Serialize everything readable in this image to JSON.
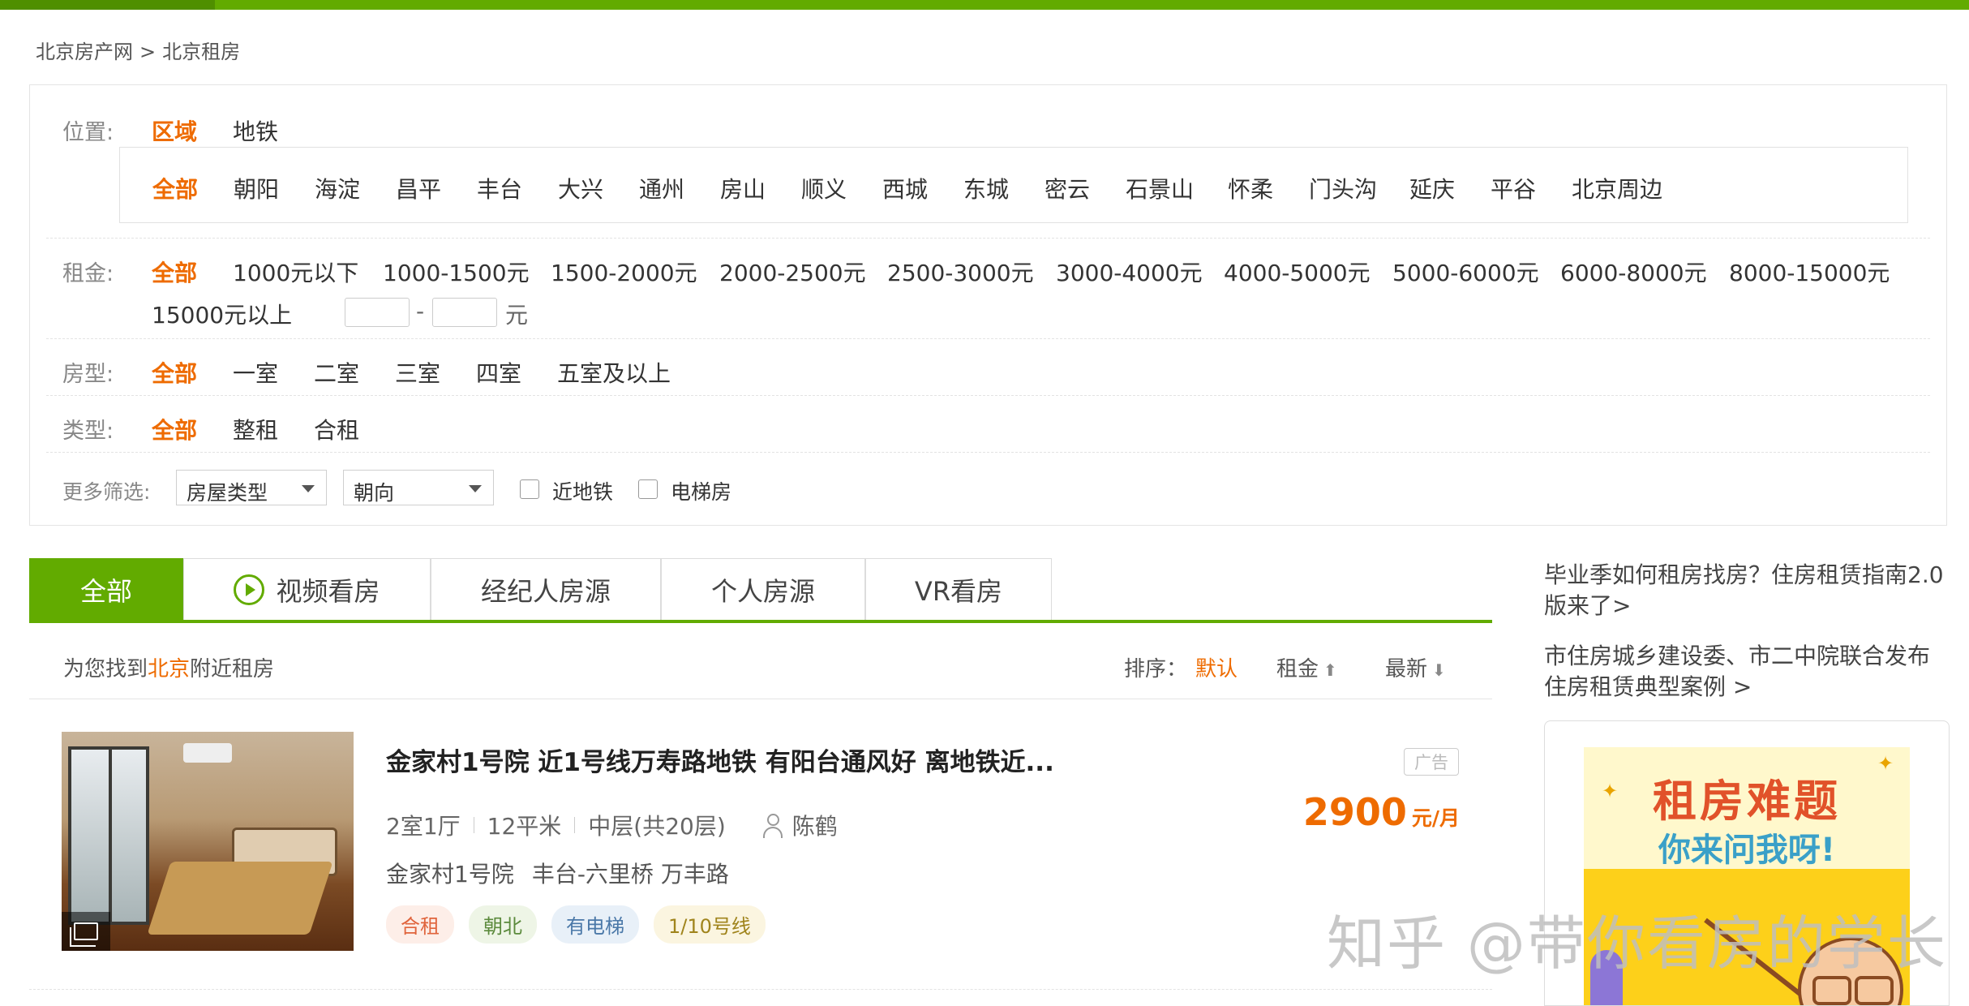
{
  "breadcrumb": {
    "home": "北京房产网",
    "separator": ">",
    "current": "北京租房"
  },
  "filters": {
    "location": {
      "label": "位置:",
      "tabs": [
        "区域",
        "地铁"
      ],
      "districts": [
        "全部",
        "朝阳",
        "海淀",
        "昌平",
        "丰台",
        "大兴",
        "通州",
        "房山",
        "顺义",
        "西城",
        "东城",
        "密云",
        "石景山",
        "怀柔",
        "门头沟",
        "延庆",
        "平谷",
        "北京周边"
      ]
    },
    "rent": {
      "label": "租金:",
      "options": [
        "全部",
        "1000元以下",
        "1000-1500元",
        "1500-2000元",
        "2000-2500元",
        "2500-3000元",
        "3000-4000元",
        "4000-5000元",
        "5000-6000元",
        "6000-8000元",
        "8000-15000元",
        "15000元以上"
      ],
      "range_dash": "-",
      "range_unit": "元"
    },
    "layout": {
      "label": "房型:",
      "options": [
        "全部",
        "一室",
        "二室",
        "三室",
        "四室",
        "五室及以上"
      ]
    },
    "type": {
      "label": "类型:",
      "options": [
        "全部",
        "整租",
        "合租"
      ]
    },
    "more": {
      "label": "更多筛选:",
      "house_type_select": "房屋类型",
      "orientation_select": "朝向",
      "near_subway": "近地铁",
      "elevator": "电梯房"
    }
  },
  "tabs": [
    "全部",
    "视频看房",
    "经纪人房源",
    "个人房源",
    "VR看房"
  ],
  "results": {
    "prefix": "为您找到",
    "city": "北京",
    "suffix": "附近租房",
    "sort_label": "排序：",
    "sort_default": "默认",
    "sort_rent": "租金",
    "sort_newest": "最新",
    "icons": {
      "rent_arrow": "arrow-up-icon",
      "newest_arrow": "arrow-down-icon"
    }
  },
  "listing": {
    "title": "金家村1号院 近1号线万寿路地铁 有阳台通风好 离地铁近...",
    "rooms": "2室1厅",
    "area": "12平米",
    "floor": "中层(共20层)",
    "agent": "陈鹤",
    "community": "金家村1号院",
    "location": "丰台-六里桥 万丰路",
    "tags": [
      {
        "text": "合租",
        "color": "#e0643c",
        "bg": "#fdeee8"
      },
      {
        "text": "朝北",
        "color": "#5b8a3c",
        "bg": "#eef5e6"
      },
      {
        "text": "有电梯",
        "color": "#4a78a8",
        "bg": "#e8f0f8"
      },
      {
        "text": "1/10号线",
        "color": "#a0841c",
        "bg": "#fbf5e0"
      }
    ],
    "ad_badge": "广告",
    "price": "2900",
    "price_unit": "元/月"
  },
  "sidebar": {
    "link1": "毕业季如何租房找房？住房租赁指南2.0版来了>",
    "link2": "市住房城乡建设委、市二中院联合发布住房租赁典型案例 >",
    "ad": {
      "headline": "租房难题",
      "subline": "你来问我呀!"
    }
  },
  "watermark": "知乎 @带你看房的学长",
  "colors": {
    "brand_green": "#62ab00",
    "accent_orange": "#ee6b00"
  }
}
